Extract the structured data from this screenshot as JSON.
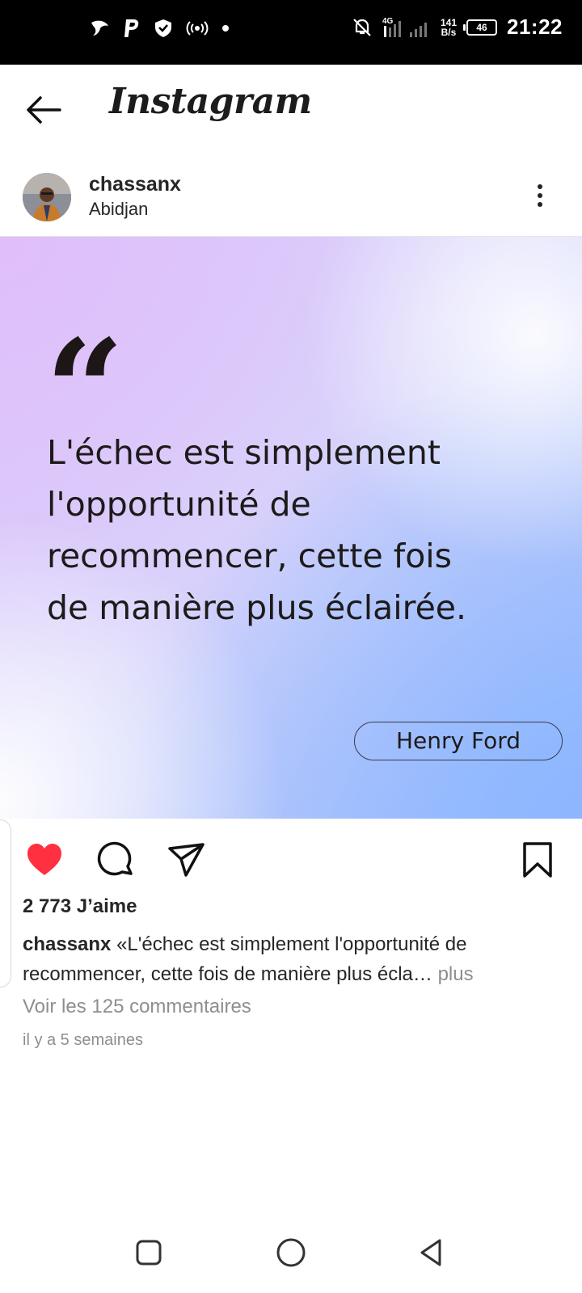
{
  "status_bar": {
    "time": "21:22",
    "net_speed_value": "141",
    "net_speed_unit": "B/s",
    "network_type": "4G",
    "battery": "46",
    "left_icons": [
      "bird-app-icon",
      "paypal-icon",
      "shield-icon",
      "hotspot-icon",
      "dot-icon"
    ],
    "right_icons": [
      "bell-off-icon",
      "signal-icon"
    ]
  },
  "header": {
    "title": "Instagram",
    "back_icon": "arrow-left-icon"
  },
  "post": {
    "username": "chassanx",
    "location": "Abidjan",
    "image": {
      "quote_mark": "“",
      "quote_lines": [
        "L'échec est simplement",
        "l'opportunité de",
        "recommencer, cette fois",
        "de manière plus éclairée."
      ],
      "author": "Henry Ford"
    },
    "likes": "2 773 J’aime",
    "caption_user": "chassanx",
    "caption_text": "«L'échec est simplement l'opportunité de recommencer, cette fois de manière plus écla… ",
    "caption_more": "plus",
    "view_comments": "Voir les 125 commentaires",
    "time_ago": "il y a 5 semaines",
    "liked": true,
    "like_color": "#ff3040"
  },
  "nav": {
    "buttons": [
      "square-recents-icon",
      "circle-home-icon",
      "triangle-back-icon"
    ]
  }
}
